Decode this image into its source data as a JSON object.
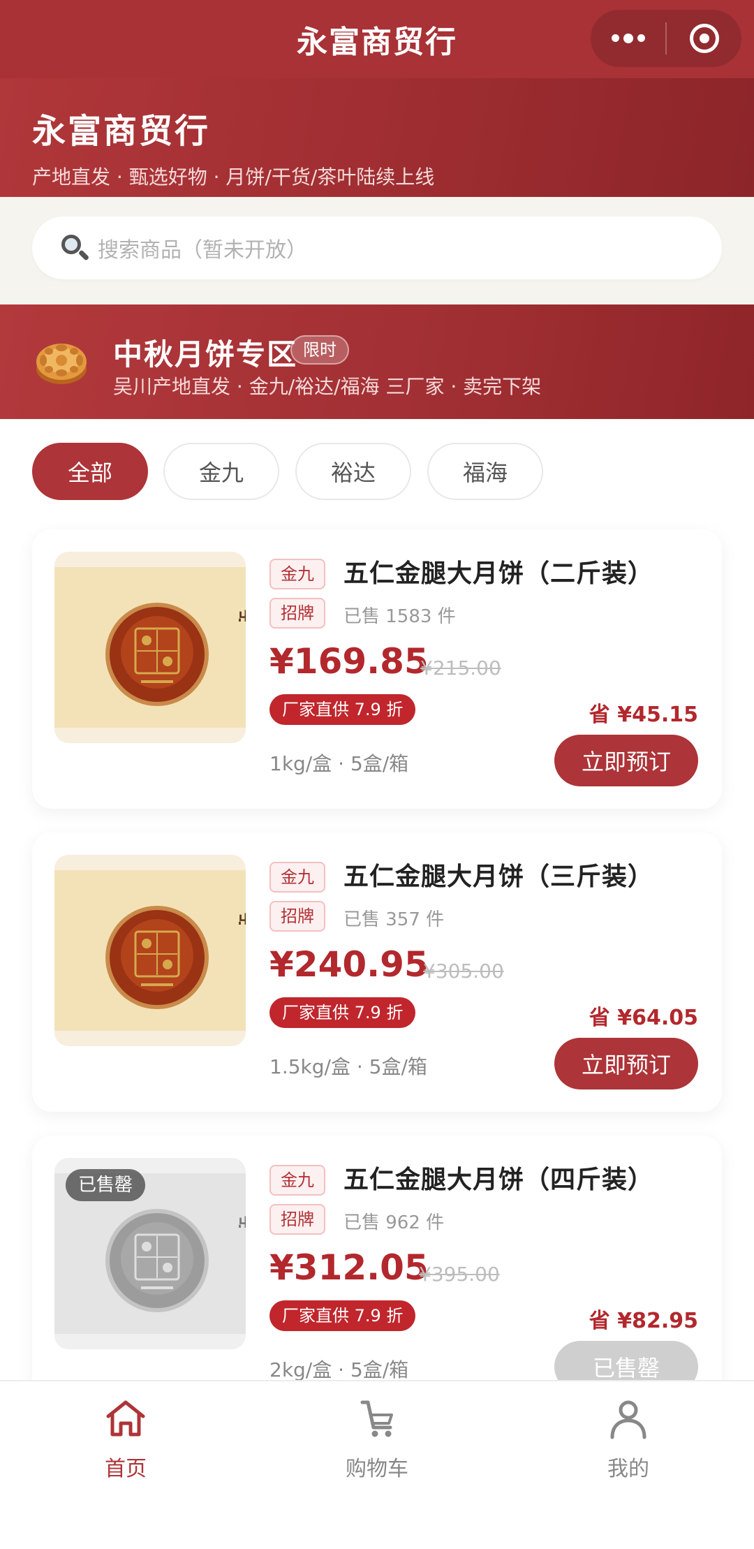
{
  "navbar": {
    "title": "永富商贸行"
  },
  "hero": {
    "title": "永富商贸行",
    "subtitle": "产地直发 · 甄选好物 · 月饼/干货/茶叶陆续上线"
  },
  "search": {
    "placeholder": "搜索商品（暂未开放）"
  },
  "promo": {
    "title": "中秋月饼专区",
    "tag": "限时",
    "subtitle": "吴川产地直发 · 金九/裕达/福海 三厂家 · 卖完下架"
  },
  "filters": [
    {
      "label": "全部",
      "active": true
    },
    {
      "label": "金九",
      "active": false
    },
    {
      "label": "裕达",
      "active": false
    },
    {
      "label": "福海",
      "active": false
    }
  ],
  "products": [
    {
      "brand": "金九",
      "badge": "招牌",
      "name": "五仁金腿大月饼（二斤装）",
      "sold": "已售 1583 件",
      "price": "¥169.85",
      "original_price": "¥215.00",
      "discount": "厂家直供 7.9 折",
      "save": "省 ¥45.15",
      "spec": "1kg/盒 · 5盒/箱",
      "button": "立即预订",
      "sold_out": false
    },
    {
      "brand": "金九",
      "badge": "招牌",
      "name": "五仁金腿大月饼（三斤装）",
      "sold": "已售 357 件",
      "price": "¥240.95",
      "original_price": "¥305.00",
      "discount": "厂家直供 7.9 折",
      "save": "省 ¥64.05",
      "spec": "1.5kg/盒 · 5盒/箱",
      "button": "立即预订",
      "sold_out": false
    },
    {
      "brand": "金九",
      "badge": "招牌",
      "name": "五仁金腿大月饼（四斤装）",
      "sold": "已售 962 件",
      "price": "¥312.05",
      "original_price": "¥395.00",
      "discount": "厂家直供 7.9 折",
      "save": "省 ¥82.95",
      "spec": "2kg/盒 · 5盒/箱",
      "button": "已售罄",
      "sold_out": true,
      "sold_out_label": "已售罄"
    }
  ],
  "tabbar": [
    {
      "label": "首页",
      "icon": "home-icon",
      "active": true
    },
    {
      "label": "购物车",
      "icon": "cart-icon",
      "active": false
    },
    {
      "label": "我的",
      "icon": "user-icon",
      "active": false
    }
  ],
  "colors": {
    "brand": "#ad3438",
    "price": "#b2282d",
    "page_bg": "#f6f4ef"
  }
}
